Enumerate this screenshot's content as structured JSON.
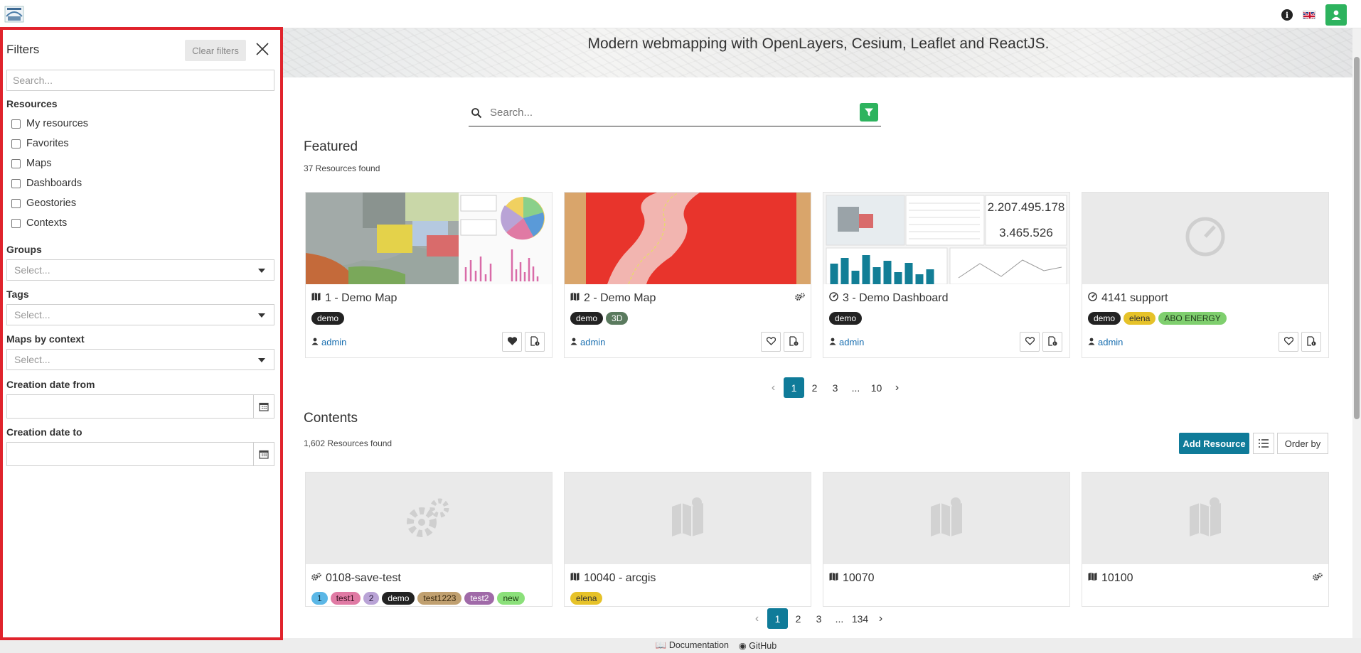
{
  "hero": {
    "subtitle": "Modern webmapping with OpenLayers, Cesium, Leaflet and ReactJS."
  },
  "filters": {
    "title": "Filters",
    "clear_label": "Clear filters",
    "search_placeholder": "Search...",
    "resources_label": "Resources",
    "resource_options": [
      "My resources",
      "Favorites",
      "Maps",
      "Dashboards",
      "Geostories",
      "Contexts"
    ],
    "groups_label": "Groups",
    "groups_placeholder": "Select...",
    "tags_label": "Tags",
    "tags_placeholder": "Select...",
    "context_label": "Maps by context",
    "context_placeholder": "Select...",
    "date_from_label": "Creation date from",
    "date_to_label": "Creation date to"
  },
  "search": {
    "placeholder": "Search..."
  },
  "featured": {
    "title": "Featured",
    "count": "37 Resources found",
    "cards": [
      {
        "title": "1 - Demo Map",
        "type_icon": "map-icon",
        "tags": [
          {
            "label": "demo",
            "bg": "#222222",
            "fg": "#ffffff"
          }
        ],
        "user": "admin",
        "favorite": true
      },
      {
        "title": "2 - Demo Map",
        "type_icon": "map-icon",
        "tags": [
          {
            "label": "demo",
            "bg": "#222222",
            "fg": "#ffffff"
          },
          {
            "label": "3D",
            "bg": "#5a7a5e",
            "fg": "#ffffff"
          }
        ],
        "user": "admin",
        "favorite": false,
        "context_icon": "gears-icon"
      },
      {
        "title": "3 - Demo Dashboard",
        "type_icon": "dashboard-icon",
        "tags": [
          {
            "label": "demo",
            "bg": "#222222",
            "fg": "#ffffff"
          }
        ],
        "user": "admin",
        "favorite": false,
        "kpi_values": [
          "2.207.495.178",
          "3.465.526"
        ]
      },
      {
        "title": "4141 support",
        "type_icon": "dashboard-icon",
        "tags": [
          {
            "label": "demo",
            "bg": "#222222",
            "fg": "#ffffff"
          },
          {
            "label": "elena",
            "bg": "#e6c229",
            "fg": "#333333"
          },
          {
            "label": "ABO ENERGY",
            "bg": "#7fcf6e",
            "fg": "#1f3a1a"
          }
        ],
        "user": "admin",
        "favorite": false
      }
    ],
    "pagination": [
      "1",
      "2",
      "3",
      "...",
      "10"
    ]
  },
  "contents": {
    "title": "Contents",
    "count": "1,602 Resources found",
    "add_label": "Add Resource",
    "order_label": "Order by",
    "cards": [
      {
        "title": "0108-save-test",
        "type_icon": "gears-icon",
        "tags": [
          {
            "label": "1",
            "bg": "#5bb7e6",
            "fg": "#113344"
          },
          {
            "label": "test1",
            "bg": "#e07aa4",
            "fg": "#3a1122"
          },
          {
            "label": "2",
            "bg": "#b9a3d6",
            "fg": "#2a1a3a"
          },
          {
            "label": "demo",
            "bg": "#222222",
            "fg": "#ffffff"
          },
          {
            "label": "test1223",
            "bg": "#c0a070",
            "fg": "#3a2a10"
          },
          {
            "label": "test2",
            "bg": "#a06aa8",
            "fg": "#ffffff"
          },
          {
            "label": "new",
            "bg": "#8be07a",
            "fg": "#1a3a10"
          }
        ]
      },
      {
        "title": "10040 - arcgis",
        "type_icon": "map-icon",
        "tags": [
          {
            "label": "elena",
            "bg": "#e6c229",
            "fg": "#333333"
          }
        ]
      },
      {
        "title": "10070",
        "type_icon": "map-icon",
        "tags": []
      },
      {
        "title": "10100",
        "type_icon": "map-icon",
        "tags": [],
        "context_icon": "gears-icon"
      }
    ],
    "pagination": [
      "1",
      "2",
      "3",
      "...",
      "134"
    ]
  },
  "footer": {
    "documentation": "Documentation",
    "github": "GitHub"
  },
  "colors": {
    "accent": "#0f7b99",
    "green": "#2db35e",
    "highlight_border": "#e0232c"
  }
}
